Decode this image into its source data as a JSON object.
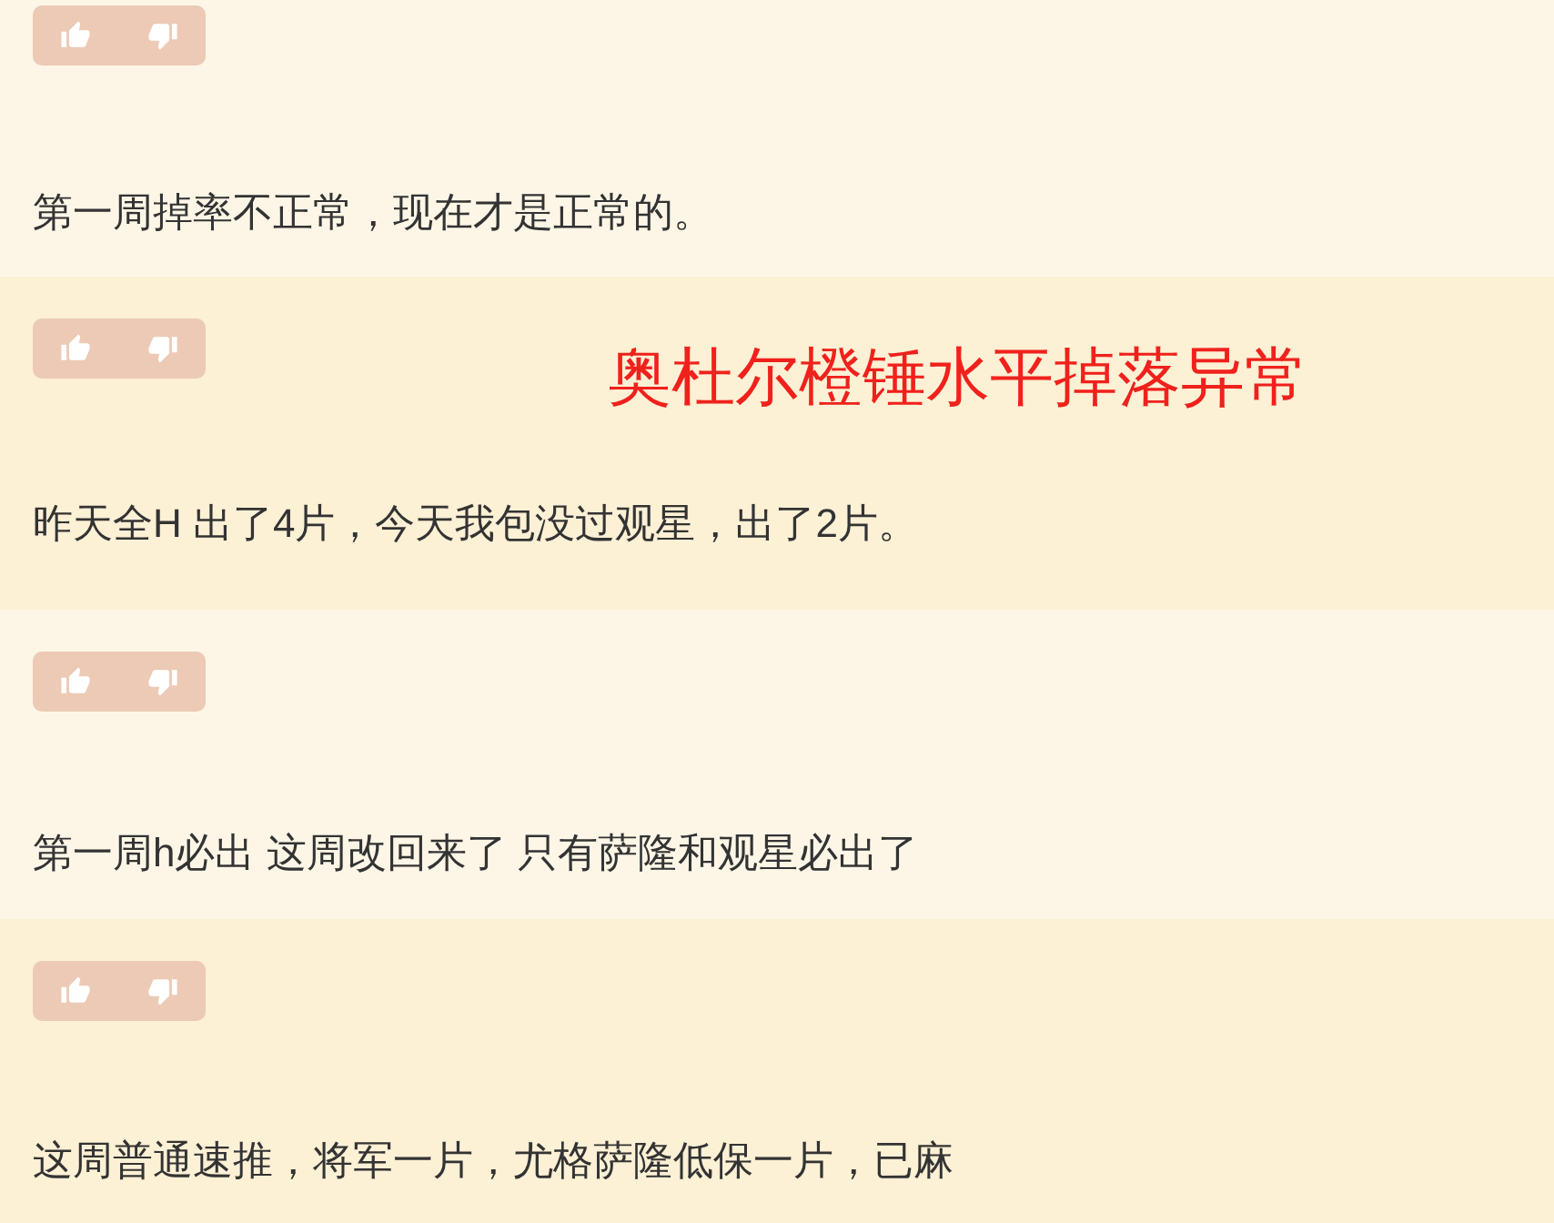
{
  "comments": [
    {
      "text": "第一周掉率不正常，现在才是正常的。"
    },
    {
      "text": "昨天全H 出了4片，今天我包没过观星，出了2片。"
    },
    {
      "text": "第一周h必出 这周改回来了 只有萨隆和观星必出了"
    },
    {
      "text": "这周普通速推，将军一片，尤格萨隆低保一片，已麻"
    }
  ],
  "overlay_caption": "奥杜尔橙锤水平掉落异常"
}
